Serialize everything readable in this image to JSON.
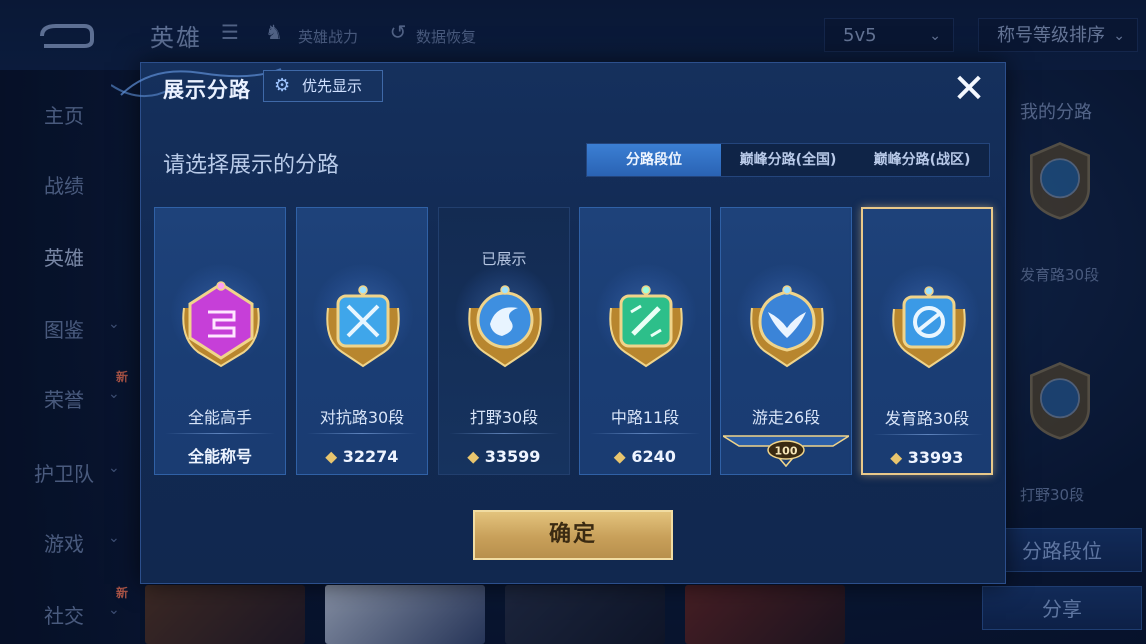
{
  "background": {
    "title": "英雄",
    "top_links": [
      "英雄战力",
      "数据恢复"
    ],
    "mode_select": "5v5",
    "sort_select": "称号等级排序",
    "sidebar": [
      {
        "label": "主页",
        "has_arrow": false
      },
      {
        "label": "战绩",
        "has_arrow": false
      },
      {
        "label": "英雄",
        "has_arrow": false,
        "active": true
      },
      {
        "label": "图鉴",
        "has_arrow": true
      },
      {
        "label": "荣誉",
        "has_arrow": true,
        "badge": "新"
      },
      {
        "label": "护卫队",
        "has_arrow": true
      },
      {
        "label": "游戏",
        "has_arrow": true
      },
      {
        "label": "社交",
        "has_arrow": true,
        "badge": "新"
      }
    ],
    "right_panel": {
      "title": "我的分路",
      "items": [
        "发育路30段",
        "打野30段"
      ],
      "lane_rank_button": "分路段位",
      "share_button": "分享"
    }
  },
  "modal": {
    "title": "展示分路",
    "priority_button": "优先显示",
    "subtitle": "请选择展示的分路",
    "tabs": [
      {
        "label": "分路段位",
        "active": true
      },
      {
        "label": "巅峰分路(全国)",
        "active": false
      },
      {
        "label": "巅峰分路(战区)",
        "active": false
      }
    ],
    "cards": [
      {
        "name": "全能高手",
        "bottom": "全能称号",
        "type": "title",
        "emblem": "all-round-emblem",
        "color": "#c63fd8"
      },
      {
        "name": "对抗路30段",
        "bottom": "32274",
        "type": "points",
        "emblem": "clash-lane-emblem",
        "color": "#3fa6ea"
      },
      {
        "name": "打野30段",
        "bottom": "33599",
        "type": "points",
        "emblem": "jungle-emblem",
        "color": "#3e8fe0",
        "shown_label": "已展示"
      },
      {
        "name": "中路11段",
        "bottom": "6240",
        "type": "points",
        "emblem": "mid-lane-emblem",
        "color": "#2dbf8a"
      },
      {
        "name": "游走26段",
        "bottom": "100",
        "type": "rank",
        "emblem": "roam-emblem",
        "color": "#3b84d8"
      },
      {
        "name": "发育路30段",
        "bottom": "33993",
        "type": "points",
        "emblem": "farm-lane-emblem",
        "color": "#3b9ae6",
        "selected": true
      }
    ],
    "confirm_button": "确定"
  }
}
